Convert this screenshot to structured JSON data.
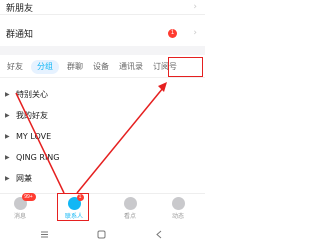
{
  "rows": {
    "new_friends": "新朋友",
    "group_notice": "群通知",
    "group_notice_badge": "1",
    "chevron": "›"
  },
  "tabs": [
    {
      "label": "好友"
    },
    {
      "label": "分组"
    },
    {
      "label": "群聊"
    },
    {
      "label": "设备"
    },
    {
      "label": "通讯录"
    },
    {
      "label": "订阅号"
    }
  ],
  "groups": [
    {
      "label": "特别关心"
    },
    {
      "label": "我的好友"
    },
    {
      "label": "MY LOVE"
    },
    {
      "label": "QING RING"
    },
    {
      "label": "网兼"
    }
  ],
  "nav": {
    "messages": {
      "label": "消息",
      "badge": "99+"
    },
    "contacts": {
      "label": "联系人",
      "badge": "1"
    },
    "watch": {
      "label": "看点"
    },
    "moments": {
      "label": "动态"
    }
  },
  "colors": {
    "accent": "#12b7f5",
    "highlight": "#e52020",
    "badge": "#ff3b30"
  },
  "icons": [
    "chevron-right-icon",
    "expand-triangle-icon",
    "message-icon",
    "contacts-icon",
    "watch-icon",
    "moments-icon",
    "menu-icon",
    "home-icon",
    "back-icon"
  ]
}
